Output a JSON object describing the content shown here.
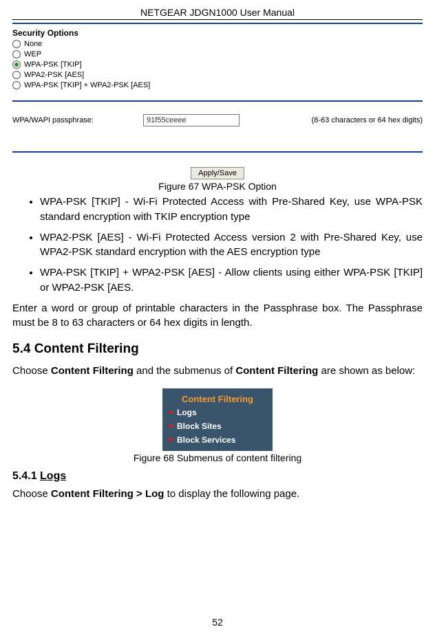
{
  "header": {
    "title": "NETGEAR JDGN1000 User Manual"
  },
  "security": {
    "title": "Security Options",
    "options": [
      {
        "label": "None",
        "selected": false
      },
      {
        "label": "WEP",
        "selected": false
      },
      {
        "label": "WPA-PSK [TKIP]",
        "selected": true
      },
      {
        "label": "WPA2-PSK [AES]",
        "selected": false
      },
      {
        "label": "WPA-PSK [TKIP] + WPA2-PSK [AES]",
        "selected": false
      }
    ],
    "passphrase_label": "WPA/WAPI passphrase:",
    "passphrase_value": "91f55ceeee",
    "passphrase_hint": "(8-63 characters or 64 hex digits)",
    "apply_label": "Apply/Save"
  },
  "fig67": "Figure 67 WPA-PSK Option",
  "bullets": [
    "WPA-PSK [TKIP] - Wi-Fi Protected Access with Pre-Shared Key, use WPA-PSK standard encryption with TKIP encryption type",
    "WPA2-PSK [AES] - Wi-Fi Protected Access version 2 with Pre-Shared Key, use WPA2-PSK standard encryption with the AES encryption type",
    "WPA-PSK [TKIP] + WPA2-PSK [AES] - Allow clients using either WPA-PSK [TKIP] or WPA2-PSK [AES."
  ],
  "para1": "Enter a word or group of printable characters in the Passphrase box. The Passphrase must be 8 to 63 characters or 64 hex digits in length.",
  "h2": "5.4  Content Filtering",
  "para2_pre": "Choose ",
  "para2_b1": "Content Filtering",
  "para2_mid": " and the submenus of ",
  "para2_b2": "Content Filtering",
  "para2_post": " are shown as below:",
  "menu": {
    "title": "Content Filtering",
    "items": [
      "Logs",
      "Block Sites",
      "Block Services"
    ]
  },
  "fig68": "Figure 68 Submenus of content filtering",
  "h3_num": "5.4.1  ",
  "h3_title": "Logs",
  "para3_pre": "Choose ",
  "para3_b": "Content Filtering > Log",
  "para3_post": " to display the following page.",
  "page_number": "52"
}
